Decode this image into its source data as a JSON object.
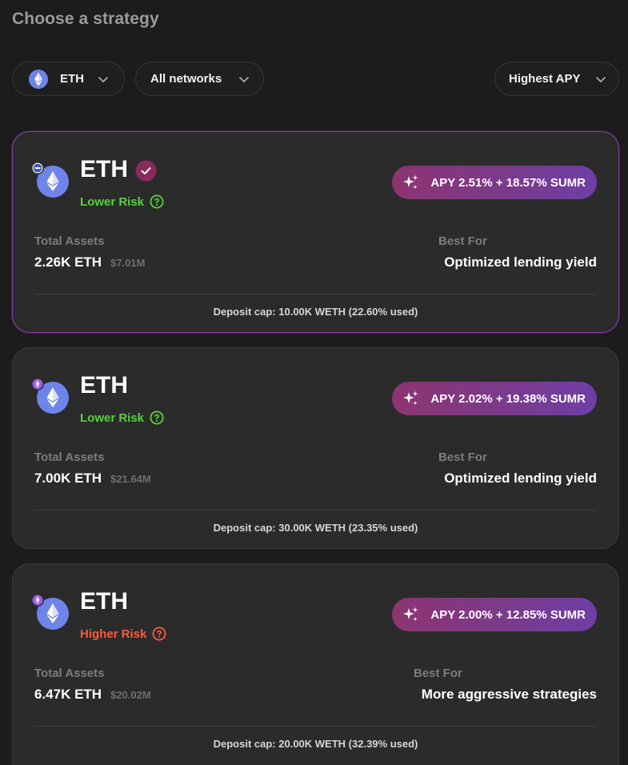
{
  "title": "Choose a strategy",
  "filters": {
    "token": {
      "label": "ETH",
      "icon": "eth-icon"
    },
    "network": {
      "label": "All networks"
    },
    "sort": {
      "label": "Highest APY"
    }
  },
  "colors": {
    "background": "#1c1c1c",
    "card": "#2b2b2b",
    "low_risk": "#57d13a",
    "high_risk": "#ff5a3c",
    "apy_gradient_start": "#8e3472",
    "apy_gradient_end": "#6e3ea6",
    "selected_border": "#8a3aa8",
    "eth_blue": "#6e84e8"
  },
  "strategies": [
    {
      "name": "ETH",
      "selected": true,
      "risk": "Lower Risk",
      "risk_level": "low",
      "apy": "APY 2.51% + 18.57% SUMR",
      "total_assets_label": "Total Assets",
      "total_assets": "2.26K ETH",
      "total_assets_usd": "$7.01M",
      "best_for_label": "Best For",
      "best_for": "Optimized lending yield",
      "deposit_cap": "Deposit cap: 10.00K WETH (22.60% used)"
    },
    {
      "name": "ETH",
      "selected": false,
      "risk": "Lower Risk",
      "risk_level": "low",
      "apy": "APY 2.02% + 19.38% SUMR",
      "total_assets_label": "Total Assets",
      "total_assets": "7.00K ETH",
      "total_assets_usd": "$21.64M",
      "best_for_label": "Best For",
      "best_for": "Optimized lending yield",
      "deposit_cap": "Deposit cap: 30.00K WETH (23.35% used)"
    },
    {
      "name": "ETH",
      "selected": false,
      "risk": "Higher Risk",
      "risk_level": "high",
      "apy": "APY 2.00% + 12.85% SUMR",
      "total_assets_label": "Total Assets",
      "total_assets": "6.47K ETH",
      "total_assets_usd": "$20.02M",
      "best_for_label": "Best For",
      "best_for": "More aggressive strategies",
      "deposit_cap": "Deposit cap: 20.00K WETH (32.39% used)"
    }
  ]
}
